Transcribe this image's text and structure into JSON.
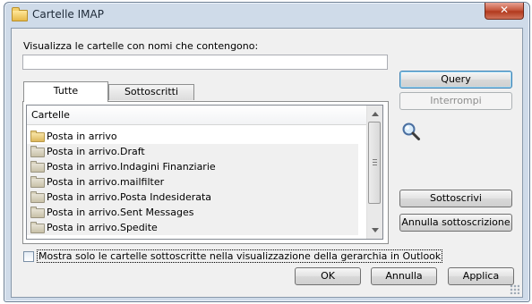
{
  "window": {
    "title": "Cartelle IMAP",
    "close_glyph": "✕"
  },
  "filter": {
    "label": "Visualizza le cartelle con nomi che contengono:",
    "value": "",
    "placeholder": ""
  },
  "tabs": [
    {
      "label": "Tutte",
      "active": true
    },
    {
      "label": "Sottoscritti",
      "active": false
    }
  ],
  "folder_list": {
    "column_header": "Cartelle",
    "items": [
      {
        "label": "Posta in arrivo",
        "icon": "folder-icon"
      },
      {
        "label": "Posta in arrivo.Draft",
        "icon": "folder-grey-icon"
      },
      {
        "label": "Posta in arrivo.Indagini Finanziarie",
        "icon": "folder-grey-icon"
      },
      {
        "label": "Posta in arrivo.mailfilter",
        "icon": "folder-grey-icon"
      },
      {
        "label": "Posta in arrivo.Posta Indesiderata",
        "icon": "folder-grey-icon"
      },
      {
        "label": "Posta in arrivo.Sent Messages",
        "icon": "folder-grey-icon"
      },
      {
        "label": "Posta in arrivo.Spedite",
        "icon": "folder-grey-icon"
      }
    ]
  },
  "side_buttons": {
    "query": "Query",
    "stop": "Interrompi",
    "subscribe": "Sottoscrivi",
    "unsubscribe": "Annulla sottoscrizione"
  },
  "checkbox": {
    "label": "Mostra solo le cartelle sottoscritte nella visualizzazione della gerarchia in Outlook",
    "checked": false
  },
  "footer_buttons": {
    "ok": "OK",
    "cancel": "Annulla",
    "apply": "Applica"
  }
}
